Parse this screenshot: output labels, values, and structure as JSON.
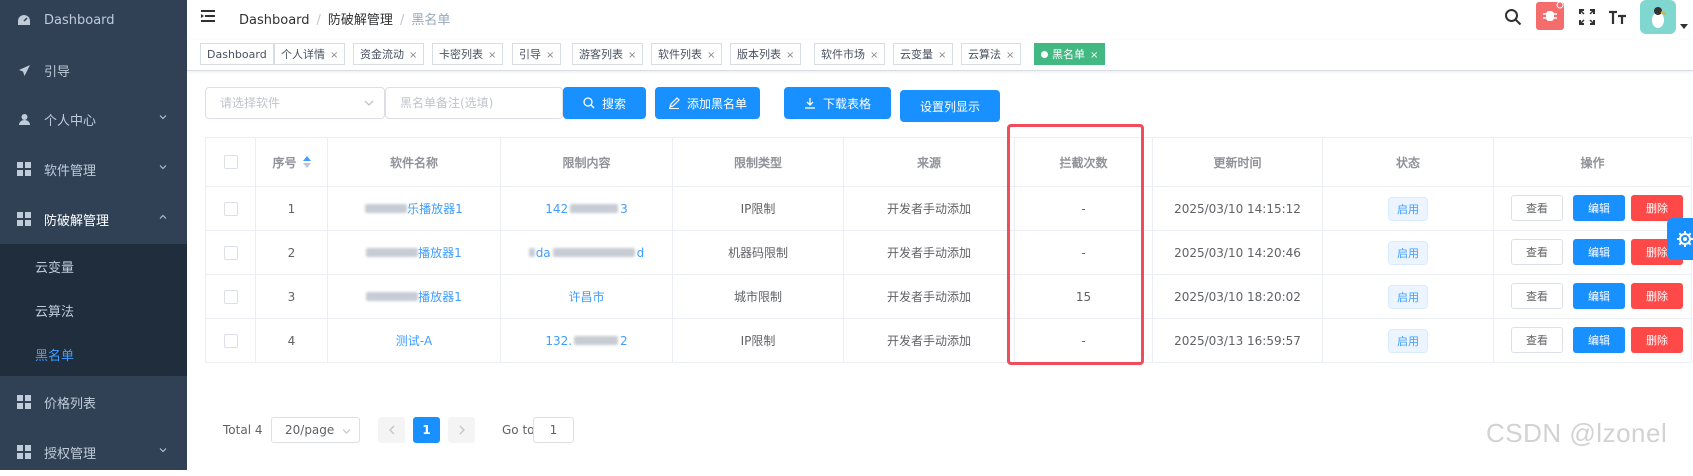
{
  "sidebar": {
    "items": [
      {
        "label": "Dashboard",
        "icon": "dashboard-icon"
      },
      {
        "label": "引导",
        "icon": "send-icon"
      },
      {
        "label": "个人中心",
        "icon": "user-icon"
      },
      {
        "label": "软件管理",
        "icon": "grid-icon"
      },
      {
        "label": "防破解管理",
        "icon": "grid-icon"
      },
      {
        "label": "价格列表",
        "icon": "grid-icon"
      },
      {
        "label": "授权管理",
        "icon": "grid-icon"
      }
    ],
    "subitems": [
      {
        "label": "云变量"
      },
      {
        "label": "云算法"
      },
      {
        "label": "黑名单",
        "active": true
      }
    ]
  },
  "breadcrumb": [
    "Dashboard",
    "防破解管理",
    "黑名单"
  ],
  "tabs": [
    "Dashboard",
    "个人详情",
    "资金流动",
    "卡密列表",
    "引导",
    "游客列表",
    "软件列表",
    "版本列表",
    "软件市场",
    "云变量",
    "云算法",
    "黑名单"
  ],
  "filters": {
    "software_placeholder": "请选择软件",
    "remark_placeholder": "黑名单备注(选填)"
  },
  "buttons": {
    "search": "搜索",
    "add": "添加黑名单",
    "download": "下载表格",
    "columns": "设置列显示"
  },
  "table": {
    "headers": [
      "序号",
      "软件名称",
      "限制内容",
      "限制类型",
      "来源",
      "拦截次数",
      "更新时间",
      "状态",
      "操作"
    ],
    "rows": [
      {
        "no": "1",
        "software": "乐播放器1",
        "content_start": "142",
        "content_end": "3",
        "type": "IP限制",
        "source": "开发者手动添加",
        "count": "-",
        "time": "2025/03/10 14:15:12",
        "status": "启用"
      },
      {
        "no": "2",
        "software": "播放器1",
        "content_start": "da",
        "content_end": "d",
        "type": "机器码限制",
        "source": "开发者手动添加",
        "count": "-",
        "time": "2025/03/10 14:20:46",
        "status": "启用"
      },
      {
        "no": "3",
        "software": "播放器1",
        "content": "许昌市",
        "type": "城市限制",
        "source": "开发者手动添加",
        "count": "15",
        "time": "2025/03/10 18:20:02",
        "status": "启用"
      },
      {
        "no": "4",
        "software": "测试-A",
        "content_start": "132.",
        "content_end": "2",
        "type": "IP限制",
        "source": "开发者手动添加",
        "count": "-",
        "time": "2025/03/13 16:59:57",
        "status": "启用"
      }
    ],
    "actions": {
      "view": "查看",
      "edit": "编辑",
      "delete": "删除"
    }
  },
  "pagination": {
    "total": "Total 4",
    "page_size": "20/page",
    "current": "1",
    "goto_label": "Go to",
    "goto_value": "1"
  },
  "watermark": "CSDN @lzonel",
  "colors": {
    "sidebar": "#304156",
    "primary": "#1890ff",
    "danger": "#ff4949",
    "active_tag": "#42b983",
    "highlight": "#f04c5c"
  }
}
